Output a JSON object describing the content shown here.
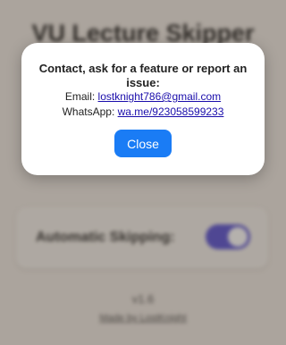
{
  "app": {
    "title": "VU Lecture Skipper"
  },
  "settings": {
    "automatic_skipping_label": "Automatic Skipping:",
    "automatic_skipping_on": true,
    "toggle_color": "#5b55d6"
  },
  "footer": {
    "version": "v1.6",
    "credit": "Made by LostKnight"
  },
  "modal": {
    "heading": "Contact, ask for a feature or report an issue:",
    "email_label": "Email: ",
    "email_value": "lostknight786@gmail.com",
    "whatsapp_label": "WhatsApp: ",
    "whatsapp_value": "wa.me/923058599233",
    "close_label": "Close",
    "button_color": "#1a7cf5"
  }
}
